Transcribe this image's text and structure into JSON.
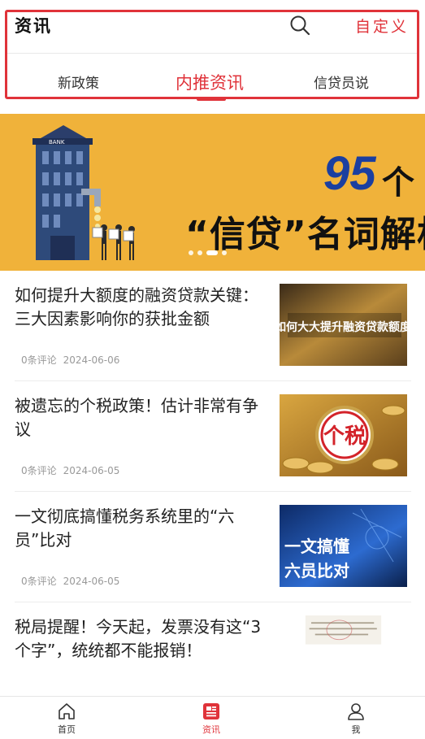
{
  "header": {
    "title": "资讯",
    "custom_label": "自定义",
    "accent": "#e0333a"
  },
  "tabs": [
    {
      "label": "新政策",
      "active": false
    },
    {
      "label": "内推资讯",
      "active": true
    },
    {
      "label": "信贷员说",
      "active": false
    }
  ],
  "banner": {
    "number": "95",
    "counter": "个",
    "subtitle": "“信贷”名词解析",
    "building_label": "BANK",
    "slides": 4,
    "active_slide": 3
  },
  "articles": [
    {
      "title": "如何提升大额度的融资贷款关键：三大因素影响你的获批金额",
      "comments": "0条评论",
      "date": "2024-06-06",
      "thumb_text": "如何大大提升融资贷款额度",
      "thumb_icon": "money-thumb"
    },
    {
      "title": "被遗忘的个税政策！估计非常有争议",
      "comments": "0条评论",
      "date": "2024-06-05",
      "thumb_text": "个税",
      "thumb_icon": "tax-thumb"
    },
    {
      "title": "一文彻底搞懂税务系统里的“六员”比对",
      "comments": "0条评论",
      "date": "2024-06-05",
      "thumb_text": "一文搞懂六员比对",
      "thumb_icon": "tech-thumb"
    },
    {
      "title": "税局提醒！今天起，发票没有这“3个字”，统统都不能报销！",
      "comments": "",
      "date": "",
      "thumb_text": "",
      "thumb_icon": "invoice-thumb"
    }
  ],
  "bottom_nav": [
    {
      "label": "首页",
      "icon": "home-icon",
      "active": false
    },
    {
      "label": "资讯",
      "icon": "news-icon",
      "active": true
    },
    {
      "label": "我",
      "icon": "user-icon",
      "active": false
    }
  ]
}
